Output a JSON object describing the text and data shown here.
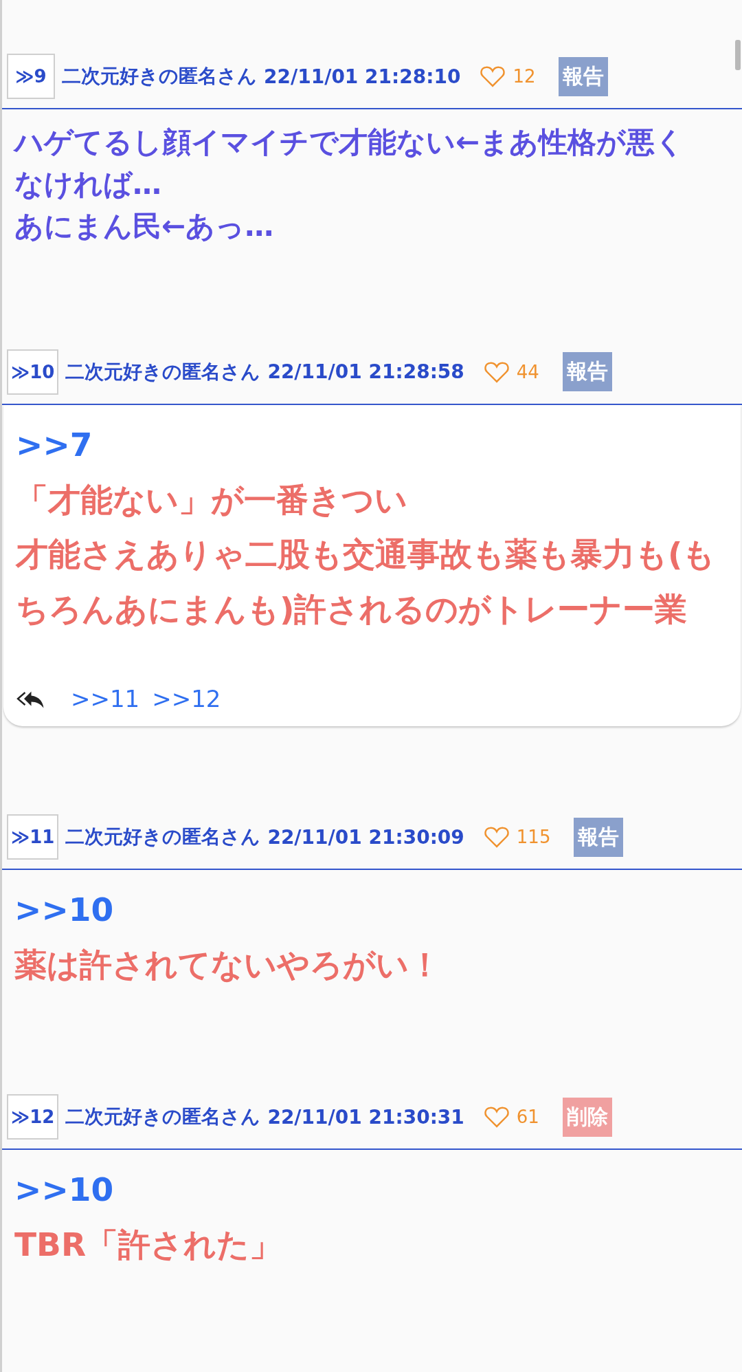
{
  "posts": [
    {
      "number": "≫9",
      "author": "二次元好きの匿名さん",
      "date": "22/11/01 21:28:10",
      "likes": "12",
      "action": {
        "kind": "report",
        "label": "報告"
      },
      "card": false,
      "body": {
        "kind": "plain",
        "lines": [
          "ハゲてるし顔イマイチで才能ない←まあ性格が悪くなければ…",
          "あにまん民←あっ…"
        ]
      }
    },
    {
      "number": "≫10",
      "author": "二次元好きの匿名さん",
      "date": "22/11/01 21:28:58",
      "likes": "44",
      "action": {
        "kind": "report",
        "label": "報告"
      },
      "card": true,
      "body": {
        "kind": "reply",
        "anchor": ">>7",
        "lines": [
          "「才能ない」が一番きつい",
          "才能さえありゃ二股も交通事故も薬も暴力も(もちろんあにまんも)許されるのがトレーナー業"
        ]
      },
      "replies": [
        ">>11",
        ">>12"
      ]
    },
    {
      "number": "≫11",
      "author": "二次元好きの匿名さん",
      "date": "22/11/01 21:30:09",
      "likes": "115",
      "action": {
        "kind": "report",
        "label": "報告"
      },
      "card": false,
      "body": {
        "kind": "reply",
        "anchor": ">>10",
        "lines": [
          "薬は許されてないやろがい！"
        ]
      }
    },
    {
      "number": "≫12",
      "author": "二次元好きの匿名さん",
      "date": "22/11/01 21:30:31",
      "likes": "61",
      "action": {
        "kind": "delete",
        "label": "削除"
      },
      "card": false,
      "body": {
        "kind": "reply",
        "anchor": ">>10",
        "lines": [
          "TBR「許された」"
        ]
      }
    }
  ]
}
